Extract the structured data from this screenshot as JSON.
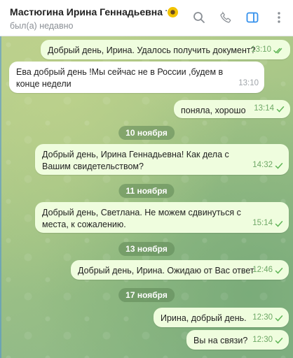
{
  "header": {
    "title": "Мастюгина Ирина Геннадьевна траст",
    "status": "был(а) недавно"
  },
  "messages": [
    {
      "text": "Добрый день, Ирина. Удалось получить документ?",
      "time": "13:10"
    },
    {
      "text": "Ева добрый день !Мы сейчас не в России ,будем в конце недели",
      "time": "13:10"
    },
    {
      "text": "поняла, хорошо",
      "time": "13:14"
    },
    {
      "text": "Добрый день, Ирина Геннадьевна! Как дела с Вашим свидетельством?",
      "time": "14:32"
    },
    {
      "text": "Добрый день, Светлана. Не можем сдвинуться с места, к сожалению.",
      "time": "15:14"
    },
    {
      "text": "Добрый день, Ирина. Ожидаю от Вас ответ",
      "time": "12:46"
    },
    {
      "text": "Ирина, добрый день.",
      "time": "12:30"
    },
    {
      "text": "Вы на связи?",
      "time": "12:30"
    }
  ],
  "dates": [
    "10 ноября",
    "11 ноября",
    "13 ноября",
    "17 ноября"
  ],
  "colors": {
    "outgoing_bubble": "#effdde",
    "incoming_bubble": "#ffffff",
    "check": "#5fb556",
    "accent": "#3390ec"
  }
}
